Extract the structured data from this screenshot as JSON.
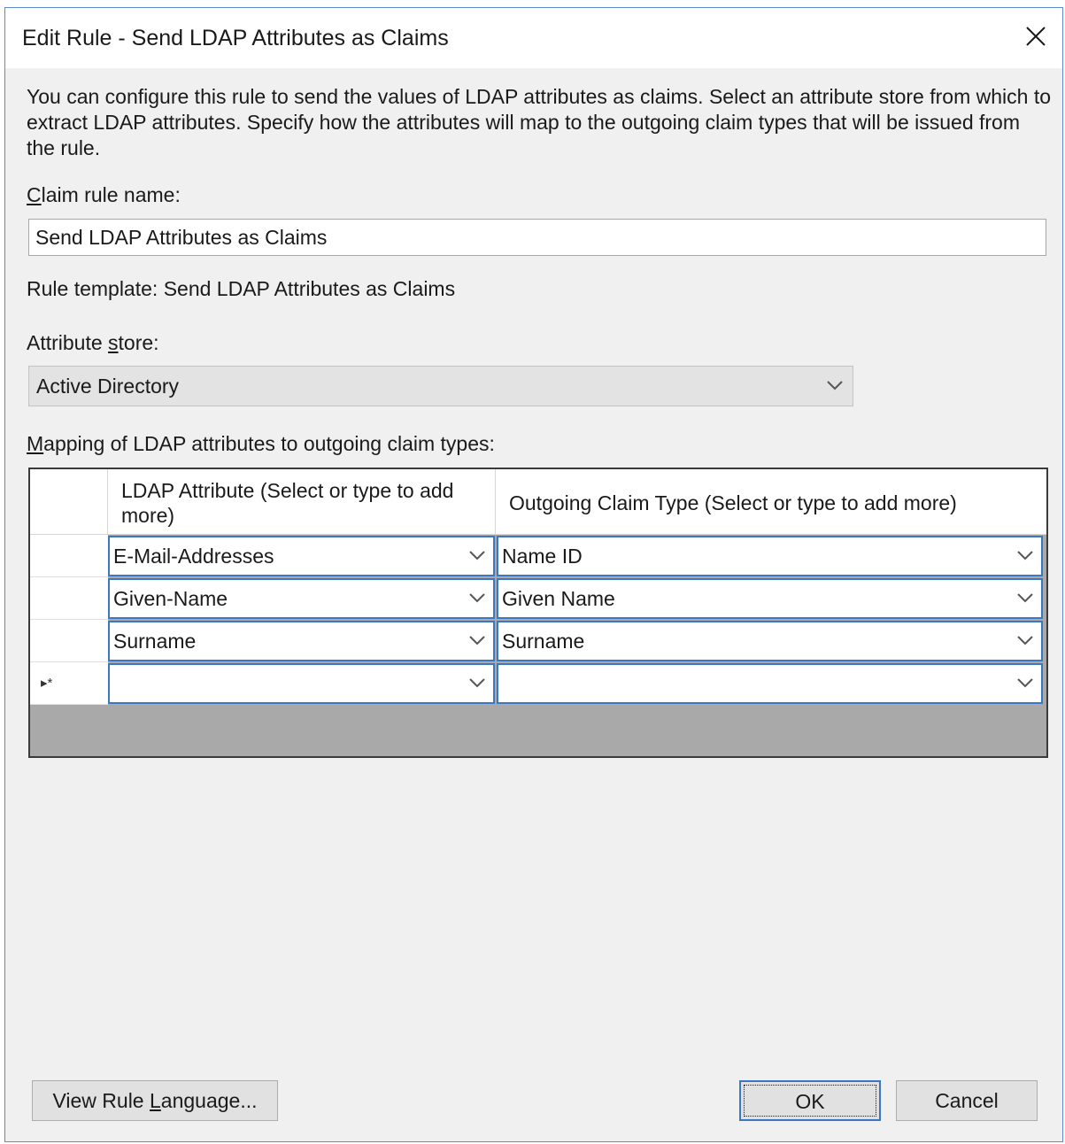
{
  "window": {
    "title": "Edit Rule - Send LDAP Attributes as Claims"
  },
  "description": "You can configure this rule to send the values of LDAP attributes as claims. Select an attribute store from which to extract LDAP attributes. Specify how the attributes will map to the outgoing claim types that will be issued from the rule.",
  "claim_rule_name": {
    "label_accel": "C",
    "label_rest": "laim rule name:",
    "value": "Send LDAP Attributes as Claims"
  },
  "rule_template": "Rule template: Send LDAP Attributes as Claims",
  "attribute_store": {
    "label_pre": "Attribute ",
    "label_accel": "s",
    "label_rest": "tore:",
    "selected": "Active Directory"
  },
  "mapping": {
    "label_accel": "M",
    "label_rest": "apping of LDAP attributes to outgoing claim types:",
    "col_ldap": "LDAP Attribute (Select or type to add more)",
    "col_claim": "Outgoing Claim Type (Select or type to add more)",
    "new_row_marker": "▸*",
    "rows": [
      {
        "ldap": "E-Mail-Addresses",
        "claim": "Name ID"
      },
      {
        "ldap": "Given-Name",
        "claim": "Given Name"
      },
      {
        "ldap": "Surname",
        "claim": "Surname"
      },
      {
        "ldap": "",
        "claim": ""
      }
    ]
  },
  "buttons": {
    "view_rule_pre": "View Rule ",
    "view_rule_accel": "L",
    "view_rule_rest": "anguage...",
    "ok": "OK",
    "cancel": "Cancel"
  },
  "icons": {
    "close": "close-icon",
    "dropdown": "chevron-down-icon"
  },
  "colors": {
    "accent": "#3a78c4",
    "dialog_bg": "#f0f0f0"
  }
}
